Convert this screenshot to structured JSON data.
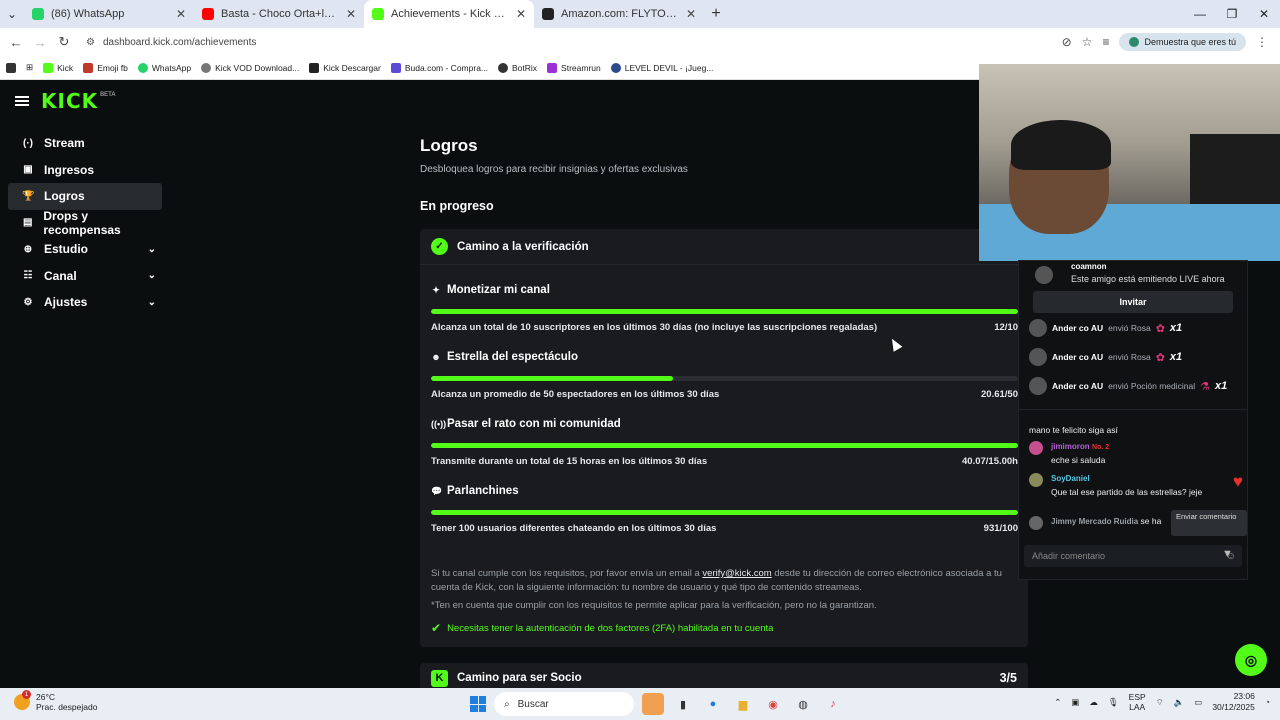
{
  "browser": {
    "tabs": [
      {
        "title": "(86) WhatsApp",
        "color": "#25d366"
      },
      {
        "title": "Basta - Choco Orta+letra (Salsa",
        "color": "#ff0000"
      },
      {
        "title": "Achievements - Kick Dashboard",
        "color": "#53fc18"
      },
      {
        "title": "Amazon.com: FLYTOCCA Moni",
        "color": "#222222"
      }
    ],
    "url": "dashboard.kick.com/achievements",
    "verify_pill": "Demuestra que eres tú",
    "bookmarks": [
      "Kick",
      "Emoji fb",
      "WhatsApp",
      "Kick VOD Download...",
      "Kick Descargar",
      "Buda.com - Compra...",
      "BotRix",
      "Streamrun",
      "LEVEL DEVIL - ¡Jueg..."
    ]
  },
  "app": {
    "logo": "KICK",
    "beta": "BETA",
    "sidebar": [
      {
        "label": "Stream",
        "icon": "(·)"
      },
      {
        "label": "Ingresos",
        "icon": "▣"
      },
      {
        "label": "Logros",
        "icon": "🏆"
      },
      {
        "label": "Drops y recompensas",
        "icon": "▤"
      },
      {
        "label": "Estudio",
        "icon": "⊕"
      },
      {
        "label": "Canal",
        "icon": "☷"
      },
      {
        "label": "Ajustes",
        "icon": "⚙"
      }
    ],
    "accent": "#53fc18"
  },
  "main": {
    "title": "Logros",
    "subtitle": "Desbloquea logros para recibir insignias y ofertas exclusivas",
    "in_progress": "En progreso",
    "card_title": "Camino a la verificación",
    "achievements": [
      {
        "title": "Monetizar mi canal",
        "icon": "✦",
        "desc": "Alcanza un total de 10 suscriptores en los últimos 30 días (no incluye las suscripciones regaladas)",
        "value": "12/10",
        "progress": 1.0
      },
      {
        "title": "Estrella del espectáculo",
        "icon": "☻",
        "desc": "Alcanza un promedio de 50 espectadores en los últimos 30 días",
        "value": "20.61/50",
        "progress": 0.4122
      },
      {
        "title": "Pasar el rato con mi comunidad",
        "icon": "((•))",
        "desc": "Transmite durante un total de 15 horas en los últimos 30 días",
        "value": "40.07/15.00h",
        "progress": 1.0
      },
      {
        "title": "Parlanchines",
        "icon": "💬",
        "desc": "Tener 100 usuarios diferentes chateando en los últimos 30 días",
        "value": "931/100",
        "progress": 1.0
      }
    ],
    "note_pre": "Si tu canal cumple con los requisitos, por favor envía un email a",
    "note_email": "verify@kick.com",
    "note_post": "desde tu dirección de correo electrónico asociada a tu cuenta de Kick, con la siguiente información: tu nombre de usuario y qué tipo de contenido streameas.",
    "note2": "*Ten en cuenta que cumplir con los requisitos te permite aplicar para la verificación, pero no la garantizan.",
    "twofa": "Necesitas tener la autenticación de dos factores (2FA) habilitada en tu cuenta",
    "card2_title": "Camino para ser Socio",
    "card2_count": "3/5"
  },
  "chat": {
    "invite_name": "coamnon",
    "invite_text": "Este amigo está emitiendo LIVE ahora",
    "invite_btn": "Invitar",
    "gifts": [
      {
        "user": "Ander co AU",
        "text": "envió Rosa",
        "mult": "x1"
      },
      {
        "user": "Ander co AU",
        "text": "envió Rosa",
        "mult": "x1"
      },
      {
        "user": "Ander co AU",
        "text": "envió Poción medicinal",
        "mult": "x1"
      }
    ],
    "messages": [
      {
        "user": "",
        "text": "mano te felicito siga así",
        "color": "#4fb8e8"
      },
      {
        "user": "jimimoron",
        "badge": "No. 2",
        "text": "eche si saluda",
        "color": "#b35fd6"
      },
      {
        "user": "SoyDaniel",
        "text": "Que tal ese partido de las estrellas? jeje",
        "color": "#53c7e8"
      },
      {
        "user": "Jimmy Mercado Ruidia",
        "text": "se ha",
        "color": "#9aa1a7"
      }
    ],
    "tooltip": "Enviar comentario",
    "comment_placeholder": "Añadir comentario"
  },
  "taskbar": {
    "temp": "26°C",
    "weather": "Prac. despejado",
    "notif": "1",
    "search": "Buscar",
    "lang1": "ESP",
    "lang2": "LAA",
    "time": "23:06",
    "date": "30/12/2025"
  }
}
